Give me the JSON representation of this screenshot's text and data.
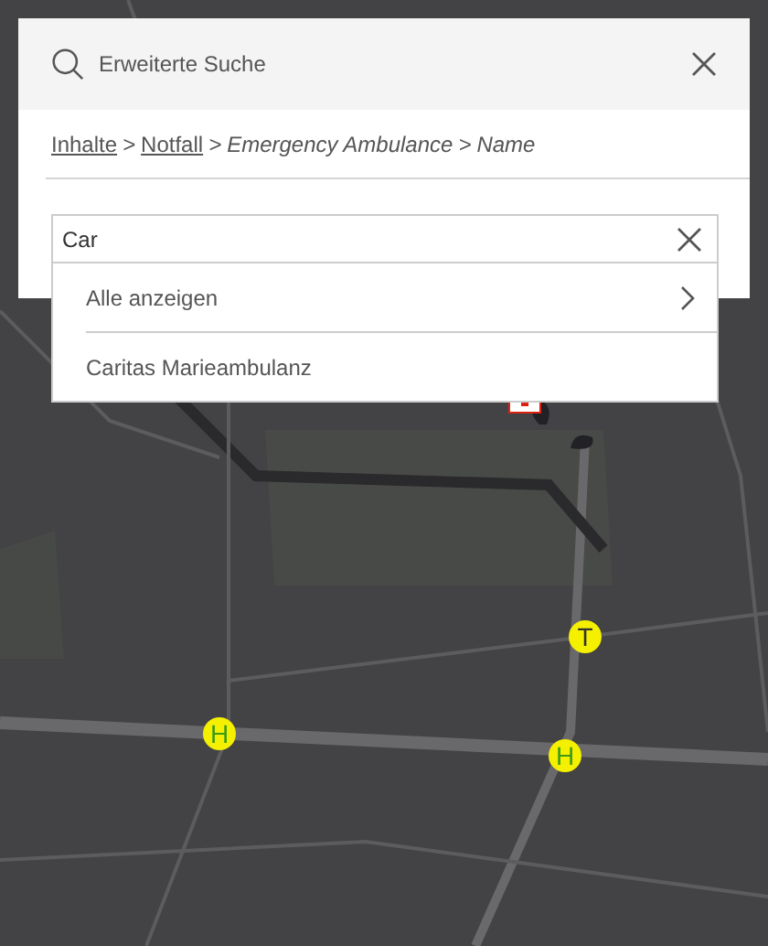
{
  "dialog": {
    "title": "Erweiterte Suche",
    "breadcrumb": [
      {
        "label": "Inhalte",
        "kind": "link"
      },
      {
        "label": "Notfall",
        "kind": "link"
      },
      {
        "label": "Emergency Ambulance",
        "kind": "text"
      },
      {
        "label": "Name",
        "kind": "text"
      }
    ],
    "separator": ">",
    "search": {
      "value": "Car"
    },
    "results": [
      {
        "label": "Alle anzeigen",
        "kind": "more"
      },
      {
        "label": "Caritas Marieambulanz",
        "kind": "item"
      }
    ]
  },
  "map": {
    "markers": [
      {
        "letter": "H",
        "kind": "stop"
      },
      {
        "letter": "T",
        "kind": "tram"
      },
      {
        "letter": "H",
        "kind": "stop"
      }
    ]
  }
}
